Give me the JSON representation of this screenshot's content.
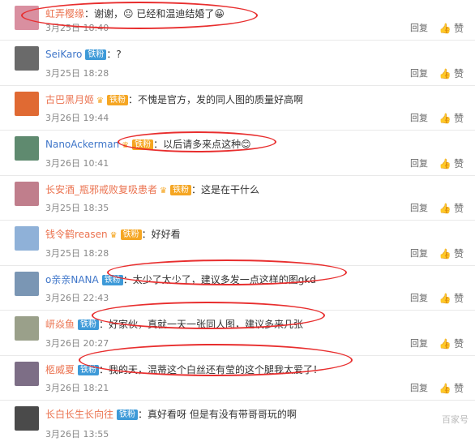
{
  "actions": {
    "reply": "回复",
    "like": "赞"
  },
  "comments": [
    {
      "name": "虹弄樱缘",
      "badge": "",
      "text": "谢谢，😐 已经和温迪结婚了😀",
      "date": "3月25日 18:40",
      "avatar_color": "#d98fa0"
    },
    {
      "name": "SeiKaro",
      "badge": "铁粉",
      "text": "?",
      "date": "3月25日 18:28",
      "avatar_color": "#6a6a6a"
    },
    {
      "name": "古巴黑月姬",
      "badge": "铁粉",
      "text": "不愧是官方，发的同人图的质量好高啊",
      "date": "3月26日 19:44",
      "avatar_color": "#e06a33"
    },
    {
      "name": "NanoAckerman",
      "badge": "铁粉",
      "text": "以后请多来点这种😊",
      "date": "3月26日 10:41",
      "avatar_color": "#5f8a6f"
    },
    {
      "name": "长安酒_瓶邪戒败复吸患者",
      "badge": "铁粉",
      "text": "这是在干什么",
      "date": "3月25日 18:35",
      "avatar_color": "#c07e8c"
    },
    {
      "name": "钱令鹤reasen",
      "badge": "铁粉",
      "text": "好好看",
      "date": "3月25日 18:28",
      "avatar_color": "#8fb1d8"
    },
    {
      "name": "o亲亲NANA",
      "badge": "铁粉",
      "text": "太少了太少了，建议多发一点这样的图gkd",
      "date": "3月26日 22:43",
      "avatar_color": "#7a96b4"
    },
    {
      "name": "岍焱鱼",
      "badge": "铁粉",
      "text": "好家伙，真就一天一张同人图，建议多来几张",
      "date": "3月26日 20:27",
      "avatar_color": "#9aa08a"
    },
    {
      "name": "柩威夏",
      "badge": "铁粉",
      "text": "我的天，温蒂这个白丝还有莹的这个腿我太爱了！",
      "date": "3月26日 18:21",
      "avatar_color": "#7d6e86"
    },
    {
      "name": "长白长生长向往",
      "badge": "铁粉",
      "text": "真好看呀 但是有没有带哥哥玩的啊",
      "date": "3月26日 13:55",
      "avatar_color": "#4a4a4a"
    }
  ],
  "watermark": "百家号"
}
